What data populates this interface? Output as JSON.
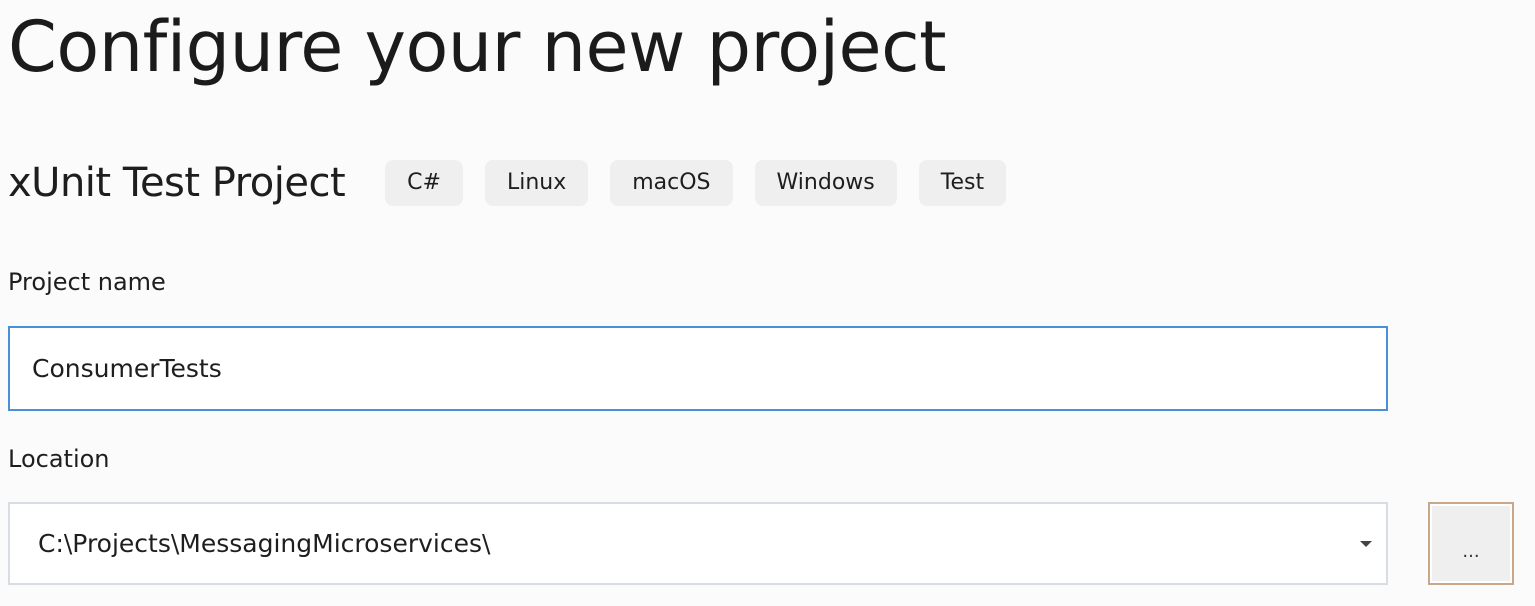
{
  "header": {
    "title": "Configure your new project"
  },
  "project": {
    "type": "xUnit Test Project",
    "tags": [
      "C#",
      "Linux",
      "macOS",
      "Windows",
      "Test"
    ]
  },
  "fields": {
    "project_name": {
      "label": "Project name",
      "value": "ConsumerTests"
    },
    "location": {
      "label": "Location",
      "value": "C:\\Projects\\MessagingMicroservices\\",
      "browse_label": "..."
    }
  }
}
